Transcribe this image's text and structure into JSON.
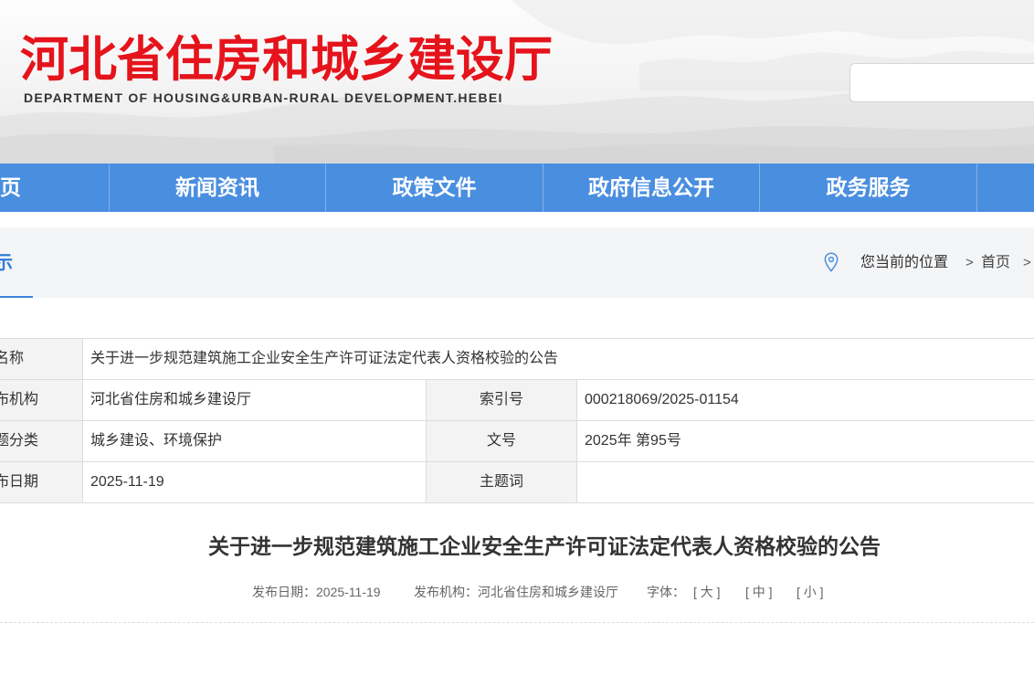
{
  "header": {
    "title": "河北省住房和城乡建设厅",
    "subtitle": "DEPARTMENT OF HOUSING&URBAN-RURAL DEVELOPMENT.HEBEI"
  },
  "nav": {
    "items": [
      {
        "label": "页"
      },
      {
        "label": "新闻资讯"
      },
      {
        "label": "政策文件"
      },
      {
        "label": "政府信息公开"
      },
      {
        "label": "政务服务"
      }
    ]
  },
  "section": {
    "title": "示",
    "breadcrumb": {
      "prefix": "您当前的位置",
      "separator": ">",
      "items": [
        {
          "label": "首页"
        }
      ]
    }
  },
  "info_table": {
    "rows": [
      {
        "label": "名称",
        "value": "关于进一步规范建筑施工企业安全生产许可证法定代表人资格校验的公告"
      },
      {
        "label": "布机构",
        "value": "河北省住房和城乡建设厅",
        "label2": "索引号",
        "value2": "000218069/2025-01154"
      },
      {
        "label": "题分类",
        "value": "城乡建设、环境保护",
        "label2": "文号",
        "value2": "2025年 第95号"
      },
      {
        "label": "布日期",
        "value": "2025-11-19",
        "label2": "主题词",
        "value2": ""
      }
    ]
  },
  "article": {
    "title": "关于进一步规范建筑施工企业安全生产许可证法定代表人资格校验的公告",
    "meta": {
      "date_label": "发布日期：",
      "date": "2025-11-19",
      "publisher_label": "发布机构：",
      "publisher": "河北省住房和城乡建设厅",
      "font_size_label": "字体：",
      "font_size_options": [
        "[ 大 ]",
        "[ 中 ]",
        "[ 小 ]"
      ]
    }
  },
  "colors": {
    "brand_red": "#e5141c",
    "nav_blue": "#4a8ee0",
    "accent_blue": "#3a86dc",
    "section_bg": "#f4f5f7",
    "table_label_bg": "#f3f3f3"
  },
  "icons": {
    "breadcrumb_location": "location-pin-icon"
  }
}
